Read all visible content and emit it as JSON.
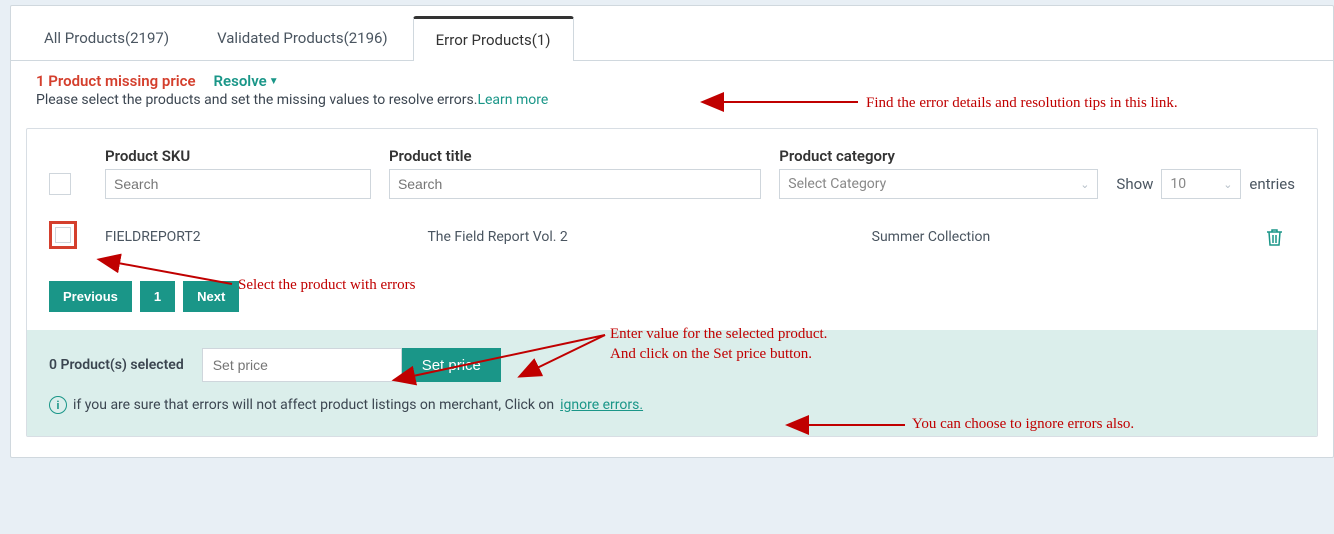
{
  "tabs": {
    "all": "All Products(2197)",
    "validated": "Validated Products(2196)",
    "error": "Error Products(1)"
  },
  "banner": {
    "error_title": "1 Product missing price",
    "resolve": "Resolve",
    "subtext": "Please select the products and set the missing values to resolve errors.",
    "learn_more": "Learn more"
  },
  "filters": {
    "sku_label": "Product SKU",
    "sku_placeholder": "Search",
    "title_label": "Product title",
    "title_placeholder": "Search",
    "category_label": "Product category",
    "category_placeholder": "Select Category",
    "show": "Show",
    "entries": "entries",
    "page_size": "10"
  },
  "row": {
    "sku": "FIELDREPORT2",
    "title": "The Field Report Vol. 2",
    "category": "Summer Collection"
  },
  "pager": {
    "prev": "Previous",
    "page1": "1",
    "next": "Next"
  },
  "footer": {
    "selected": "0 Product(s) selected",
    "price_placeholder": "Set price",
    "setprice_btn": "Set price",
    "ignore_text": "if you are sure that errors will not affect product listings on merchant, Click on",
    "ignore_link": " ignore errors."
  },
  "annotations": {
    "learn_more_tip": "Find the error details and resolution tips in this link.",
    "select_tip": "Select the product with errors",
    "enter_tip_l1": "Enter value for the selected product.",
    "enter_tip_l2": "And click on the Set price button.",
    "ignore_tip": "You can choose to ignore errors also."
  }
}
